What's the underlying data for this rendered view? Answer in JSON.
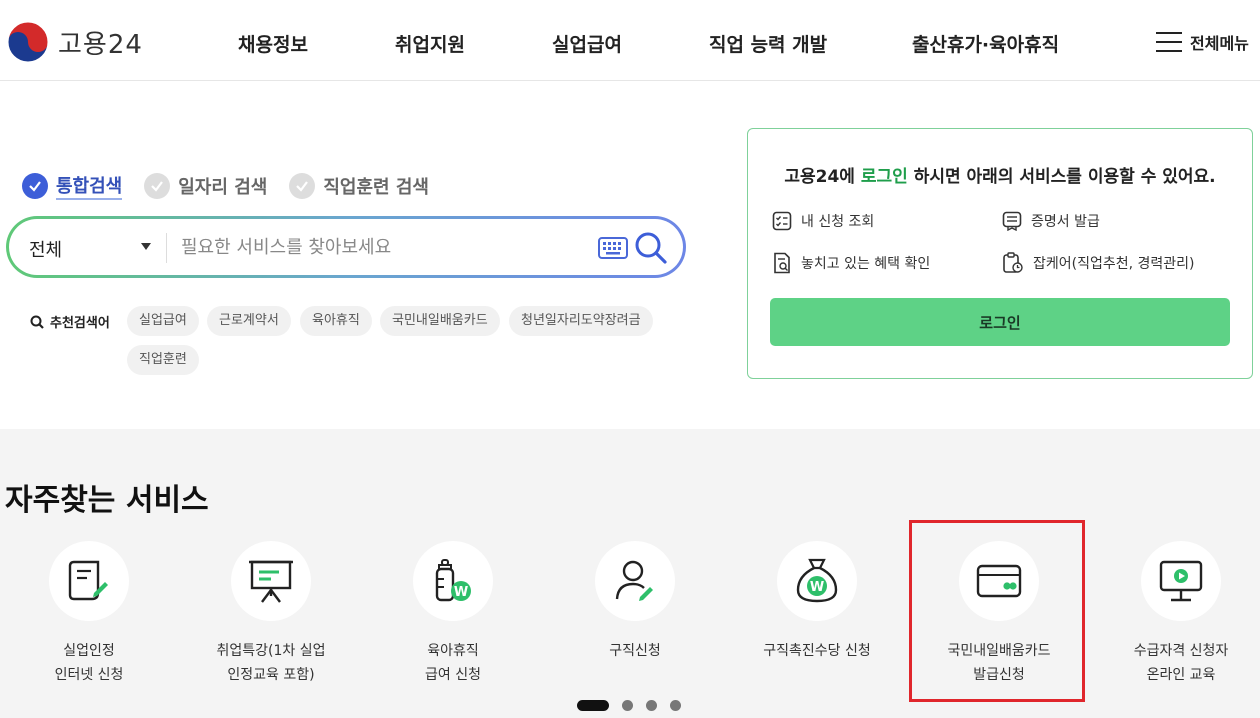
{
  "header": {
    "logo_text": "고용24",
    "nav": [
      "채용정보",
      "취업지원",
      "실업급여",
      "직업 능력 개발",
      "출산휴가·육아휴직"
    ],
    "all_menu_label": "전체메뉴"
  },
  "search": {
    "tabs": [
      {
        "label": "통합검색",
        "selected": true
      },
      {
        "label": "일자리 검색",
        "selected": false
      },
      {
        "label": "직업훈련 검색",
        "selected": false
      }
    ],
    "scope_value": "전체",
    "placeholder": "필요한 서비스를 찾아보세요",
    "recommended_label": "추천검색어",
    "recommended": [
      "실업급여",
      "근로계약서",
      "육아휴직",
      "국민내일배움카드",
      "청년일자리도약장려금",
      "직업훈련"
    ]
  },
  "login_card": {
    "title_prefix": "고용24에 ",
    "title_highlight": "로그인",
    "title_suffix": " 하시면 아래의 서비스를 이용할 수 있어요.",
    "services": [
      {
        "label": "내 신청 조회",
        "icon": "checklist-icon"
      },
      {
        "label": "증명서 발급",
        "icon": "certificate-icon"
      },
      {
        "label": "놓치고 있는 혜택 확인",
        "icon": "document-search-icon"
      },
      {
        "label": "잡케어(직업추천, 경력관리)",
        "icon": "clipboard-clock-icon"
      }
    ],
    "login_button": "로그인",
    "accent_color": "#1f9e4b"
  },
  "frequent": {
    "title": "자주찾는 서비스",
    "items": [
      {
        "label": "실업인정\n인터넷 신청",
        "icon": "receipt-pen-icon"
      },
      {
        "label": "취업특강(1차 실업\n인정교육 포함)",
        "icon": "presentation-board-icon"
      },
      {
        "label": "육아휴직\n급여 신청",
        "icon": "baby-bottle-won-icon"
      },
      {
        "label": "구직신청",
        "icon": "person-pen-icon"
      },
      {
        "label": "구직촉진수당 신청",
        "icon": "money-bag-won-icon"
      },
      {
        "label": "국민내일배움카드\n발급신청",
        "icon": "card-icon"
      },
      {
        "label": "수급자격 신청자\n온라인 교육",
        "icon": "monitor-play-icon"
      }
    ],
    "highlighted_index": 5,
    "highlight_color": "#e0262c",
    "pagination": {
      "pages": 4,
      "current": 1
    }
  }
}
